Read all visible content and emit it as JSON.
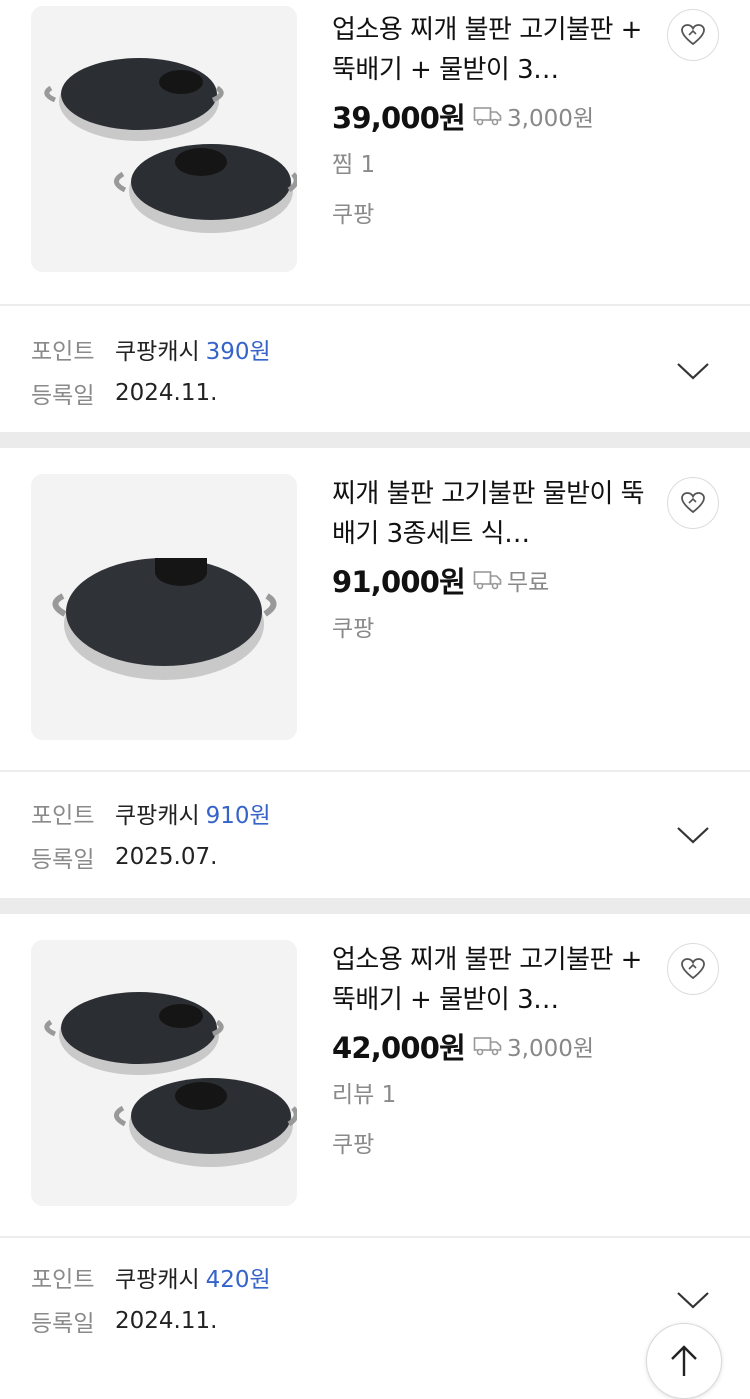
{
  "items": [
    {
      "title": "업소용 찌개 불판 고기불판 + 뚝배기 + 물받이 3…",
      "price": "39,000원",
      "shipping": "3,000원",
      "meta": [
        "찜 1",
        "쿠팡"
      ],
      "points_label": "포인트",
      "points_source": "쿠팡캐시",
      "points_amount": "390원",
      "date_label": "등록일",
      "date": "2024.11."
    },
    {
      "title": "찌개 불판 고기불판 물받이 뚝배기 3종세트 식…",
      "price": "91,000원",
      "shipping": "무료",
      "meta": [
        "쿠팡"
      ],
      "points_label": "포인트",
      "points_source": "쿠팡캐시",
      "points_amount": "910원",
      "date_label": "등록일",
      "date": "2025.07."
    },
    {
      "title": "업소용 찌개 불판 고기불판 + 뚝배기 + 물받이 3…",
      "price": "42,000원",
      "shipping": "3,000원",
      "meta": [
        "리뷰 1",
        "쿠팡"
      ],
      "points_label": "포인트",
      "points_source": "쿠팡캐시",
      "points_amount": "420원",
      "date_label": "등록일",
      "date": "2024.11."
    }
  ],
  "icons": {
    "wishlist": "heart-icon",
    "shipping": "truck-icon",
    "expand": "chevron-down-icon",
    "scroll_top": "arrow-up-icon"
  },
  "colors": {
    "accent": "#3563c9",
    "muted": "#8a8a8a",
    "separator": "#ebebeb"
  }
}
